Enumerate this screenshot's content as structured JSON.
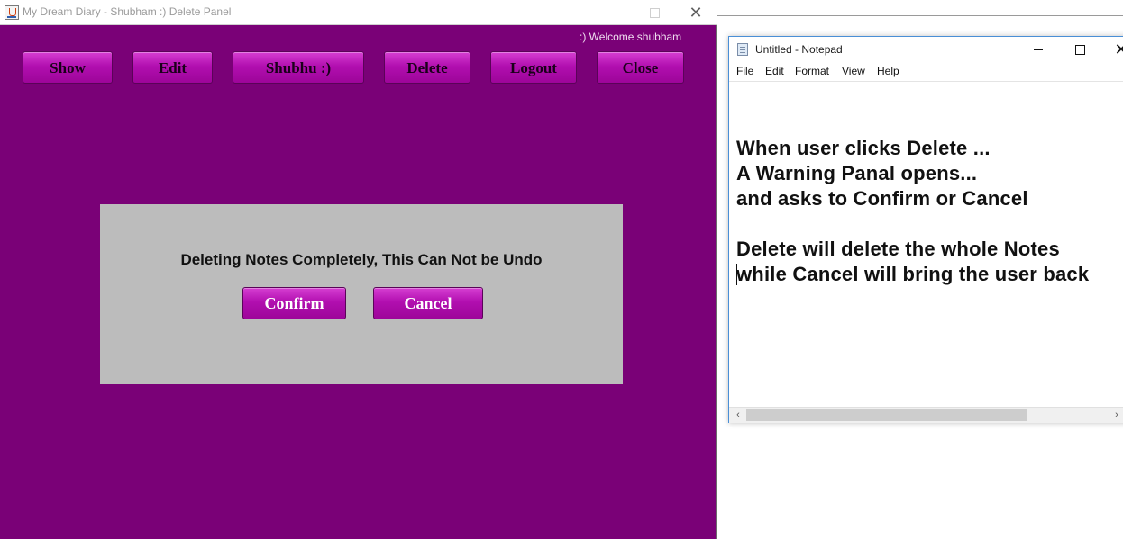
{
  "app": {
    "title": "My Dream Diary - Shubham :) Delete Panel",
    "close_glyph": "✕",
    "welcome": ":) Welcome shubham",
    "nav": {
      "show": "Show",
      "edit": "Edit",
      "shubhu": "Shubhu :)",
      "delete": "Delete",
      "logout": "Logout",
      "close": "Close"
    },
    "colors": {
      "background": "#7a0177",
      "button": "#b20fb0",
      "panel": "#bcbcbc"
    }
  },
  "warning_panel": {
    "message": "Deleting Notes Completely, This Can Not be Undo",
    "confirm": "Confirm",
    "cancel": "Cancel"
  },
  "notepad": {
    "title": "Untitled - Notepad",
    "close_glyph": "✕",
    "menu": [
      "File",
      "Edit",
      "Format",
      "View",
      "Help"
    ],
    "lines": [
      "When user clicks Delete ...",
      "A Warning Panal opens...",
      "and asks to Confirm or Cancel",
      "Delete will delete the whole Notes",
      "while Cancel will bring the user back"
    ],
    "scroll_left": "‹",
    "scroll_right": "›"
  }
}
